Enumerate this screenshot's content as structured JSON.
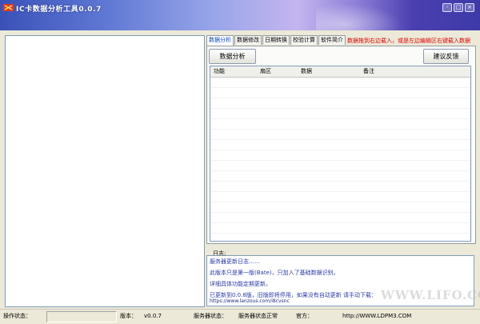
{
  "window": {
    "title": "IC卡数据分析工具0.0.7",
    "buttons": [
      "-",
      "□",
      "×"
    ]
  },
  "tabs": [
    {
      "label": "数据分析",
      "active": true
    },
    {
      "label": "数据修改",
      "active": false
    },
    {
      "label": "日期转换",
      "active": false
    },
    {
      "label": "校验计算",
      "active": false
    },
    {
      "label": "软件简介",
      "active": false
    }
  ],
  "hint": "数据拖到右边载入，或是左边编辑区右键载入数据",
  "buttons": {
    "analyze": "数据分析",
    "feedback": "建议反馈"
  },
  "table": {
    "columns": [
      "功能",
      "扇区",
      "数据",
      "备注"
    ],
    "rows": []
  },
  "log": {
    "label": "日志:",
    "lines": [
      "服务器更新日志……",
      "此版本只是第一版(Bate)，只加入了基础数据识别。",
      "详细具体功能定期更新。",
      "已更新到0.0.8版，旧版即将停用，如果没有自动更新 请手动下载：",
      "https://www.lanzous.com/i8cvsnc"
    ]
  },
  "statusbar": {
    "op_label": "操作状态：",
    "op_value": "",
    "version_label": "版本：",
    "version_value": "v0.0.7",
    "server_label": "服务器状态：",
    "server_value": "服务器状态正常",
    "official_label": "官方：",
    "official_value": "http://WWW.LDPM3.COM"
  },
  "watermark": "WWW.LIFO.COM",
  "colors": {
    "hint": "#e00000",
    "active_tab": "#0046d5",
    "log_text": "#2b3aa8"
  }
}
